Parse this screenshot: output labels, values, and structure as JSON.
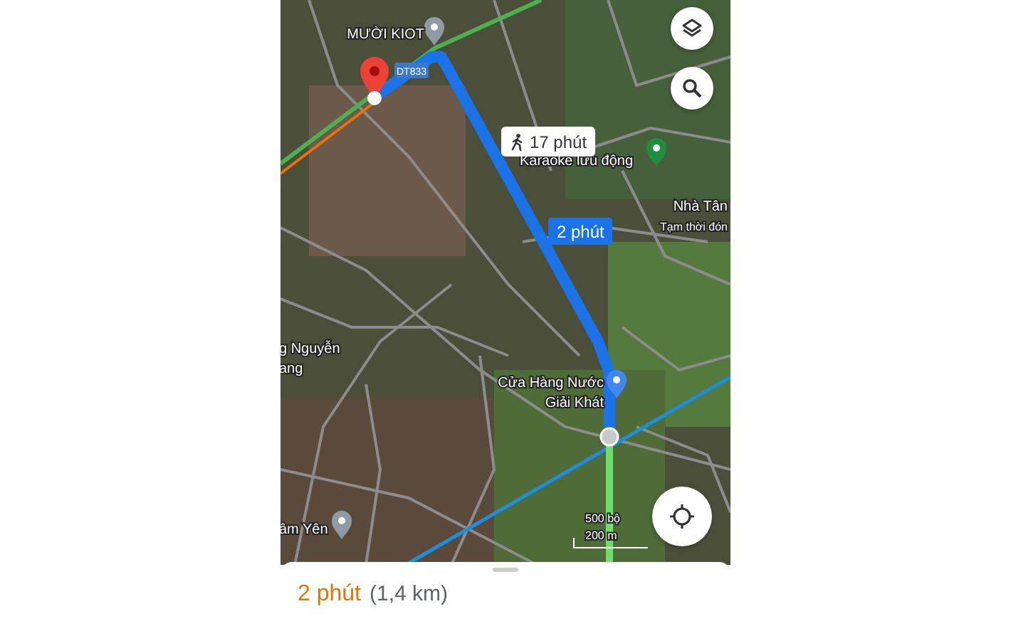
{
  "map": {
    "places": [
      {
        "kind": "pin",
        "lines": [
          "MƯỜI KIOT"
        ]
      },
      {
        "kind": "park",
        "lines": [
          "Karaoke lưu động"
        ]
      },
      {
        "kind": "label",
        "lines": [
          "Nhà Tân",
          "Tạm thời đón"
        ]
      },
      {
        "kind": "label",
        "lines": [
          "g Nguyễn",
          "ang"
        ]
      },
      {
        "kind": "shop",
        "lines": [
          "Cửa Hàng Nước",
          "Giải Khát"
        ]
      },
      {
        "kind": "pin",
        "lines": [
          "âm Yên"
        ]
      }
    ],
    "route": {
      "shield": "DT833",
      "walk_time": "17 phút",
      "drive_time": "2 phút"
    },
    "scale": {
      "imperial": "500 bộ",
      "metric": "200 m"
    }
  },
  "sheet": {
    "duration": "2 phút",
    "distance": "(1,4 km)"
  }
}
